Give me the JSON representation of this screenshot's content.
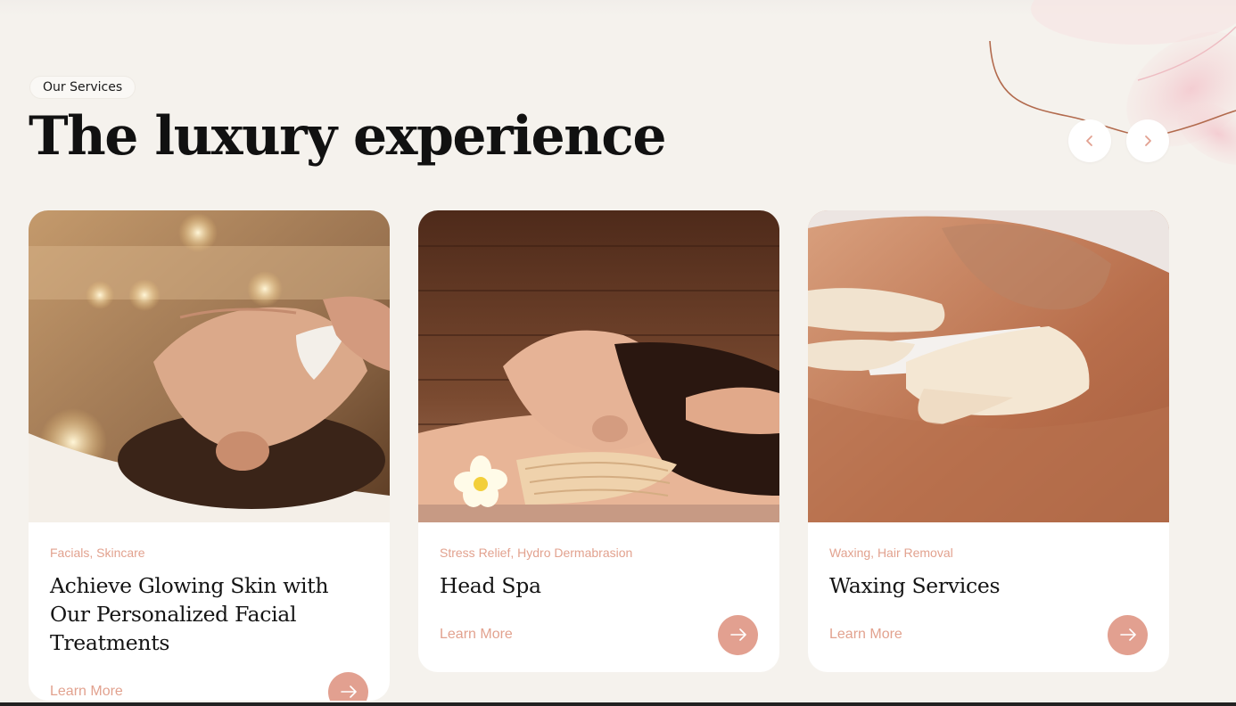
{
  "section": {
    "eyebrow": "Our Services",
    "title": "The luxury experience"
  },
  "carousel": {
    "prev_icon": "chevron-left-icon",
    "next_icon": "chevron-right-icon"
  },
  "colors": {
    "accent": "#e2a090",
    "tag_text": "#e2a28f",
    "background": "#f5f2ed",
    "deco_line": "#b26a4d"
  },
  "services": [
    {
      "tags": "Facials, Skincare",
      "title": "Achieve Glowing Skin with Our Personalized Facial Treatments",
      "link_label": "Learn More",
      "image": "woman-receiving-facial-treatment-photo"
    },
    {
      "tags": "Stress Relief, Hydro Dermabrasion",
      "title": "Head Spa",
      "link_label": "Learn More",
      "image": "woman-receiving-head-massage-photo"
    },
    {
      "tags": "Waxing, Hair Removal",
      "title": "Waxing Services",
      "link_label": "Learn More",
      "image": "chest-waxing-treatment-photo"
    }
  ]
}
